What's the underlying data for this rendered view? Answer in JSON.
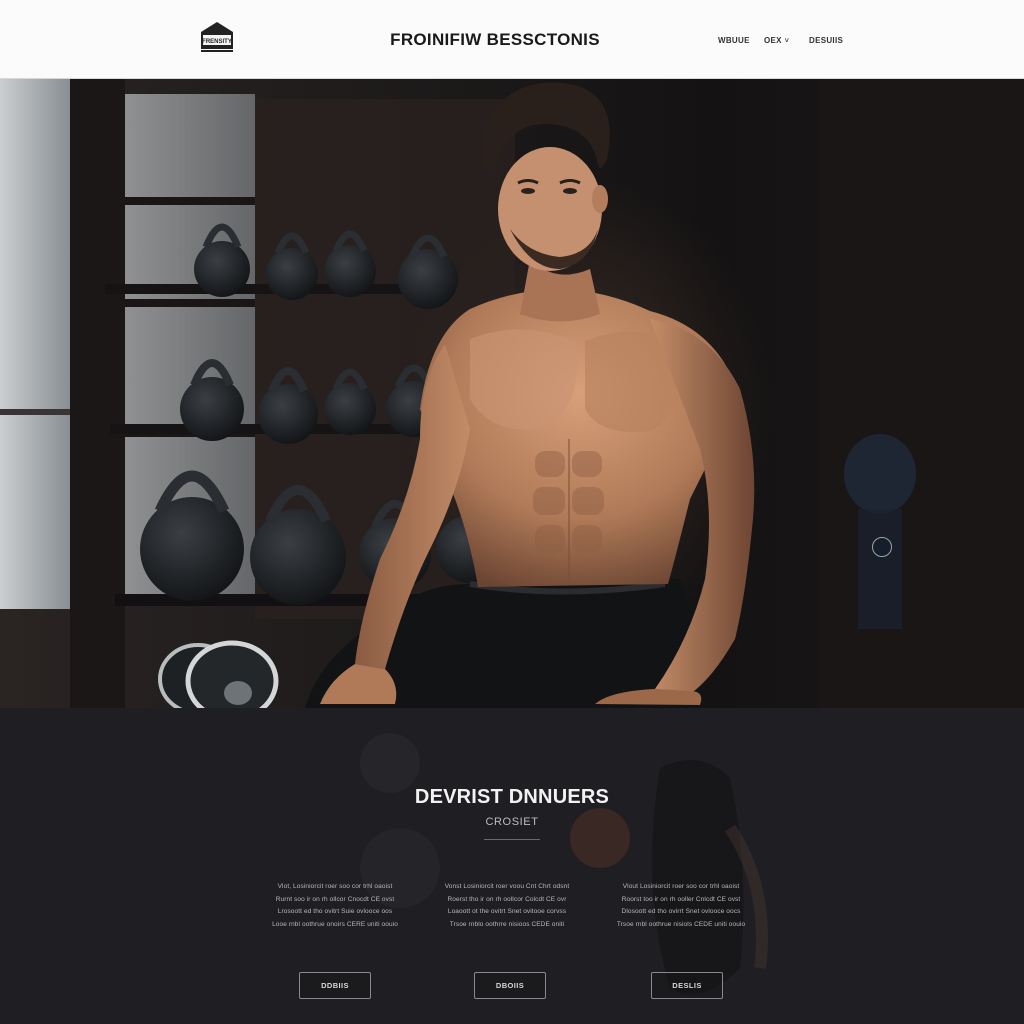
{
  "header": {
    "logo_text": "FRENSITY",
    "title": "FROINIFIW BESSCTONIS",
    "nav": [
      {
        "label": "WBUUE"
      },
      {
        "label": "OEX",
        "has_dropdown": true
      },
      {
        "label": "DESUIIS"
      }
    ]
  },
  "section": {
    "title": "DEVRIST DNNUERS",
    "subtitle": "CROSIET",
    "columns": [
      {
        "lines": [
          "Vlot, Losiniorcit roer soo cor trhl oaoist",
          "Rurnt soo ir on rh ollcor Cnocdt CE ovst",
          "Lrosoott ed tho ovitrt Suie ovlooce oos",
          "Looe rnbl oothrue onoirs CERE uniti oouio"
        ],
        "button": "DDBIIS"
      },
      {
        "lines": [
          "Vonst Losiniorcit roer voou Cnt Chrt odsnt",
          "Roerst tho ir on rh oollcor Colcdt CE ovr",
          "Loaoott ot the ovitrt Snet ovitooe corvss",
          "Trsoe rnblo oothrre nisioos CEDE oniti"
        ],
        "button": "DBOIIS"
      },
      {
        "lines": [
          "Vlout Losiniorcit roer soo cor trhl oaoist",
          "Roorst too ir on rh ooller Cnlcdt CE ovst",
          "Dlosoott ed tho ovirrt Snet ovlooce oocs",
          "Trsoe rnbl oothrue nisiols CEDE uniti oouio"
        ],
        "button": "DESLIS"
      }
    ]
  },
  "colors": {
    "header_bg": "#fbfbfb",
    "section_bg": "#1f1f23",
    "title_text": "#f2f2f2",
    "body_text": "#b9b9b9"
  }
}
